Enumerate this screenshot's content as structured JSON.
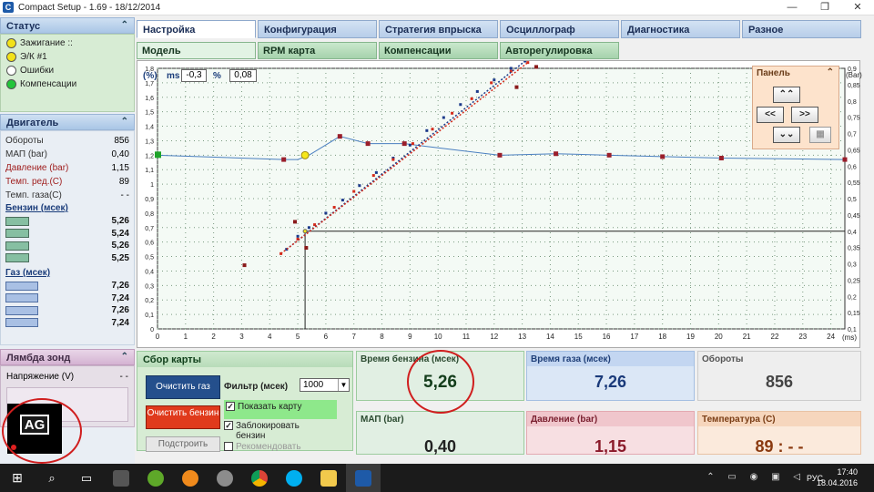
{
  "window": {
    "title": "Compact Setup - 1.69 - 18/12/2014",
    "min": "—",
    "max": "❐",
    "close": "✕"
  },
  "status": {
    "title": "Статус",
    "items": [
      {
        "label": "Зажигание ::",
        "color": "#f2e218"
      },
      {
        "label": "Э/К #1",
        "color": "#f2e218"
      },
      {
        "label": "Ошибки",
        "color": "#ffffff"
      },
      {
        "label": "Компенсации",
        "color": "#22c53a"
      }
    ]
  },
  "engine": {
    "title": "Двигатель",
    "rows": [
      {
        "label": "Обороты",
        "value": "856",
        "red": false
      },
      {
        "label": "МАП (bar)",
        "value": "0,40",
        "red": false
      },
      {
        "label": "Давление (bar)",
        "value": "1,15",
        "red": true
      },
      {
        "label": "Темп. ред.(C)",
        "value": "89",
        "red": true
      },
      {
        "label": "Темп. газа(C)",
        "value": "- -",
        "red": false
      }
    ],
    "petrol_title": "Бензин (мсек)",
    "petrol": [
      "5,26",
      "5,24",
      "5,26",
      "5,25"
    ],
    "gas_title": "Газ (мсек)",
    "gas": [
      "7,26",
      "7,24",
      "7,26",
      "7,24"
    ]
  },
  "lambda": {
    "title": "Лямбда зонд",
    "voltage_label": "Напряжение (V)",
    "voltage_value": "- -"
  },
  "logo_text": "AG",
  "tabs1": [
    "Настройка",
    "Конфигурация",
    "Стратегия впрыска",
    "Осциллограф",
    "Диагностика",
    "Разное"
  ],
  "tabs2": [
    "Модель",
    "RPM карта",
    "Компенсации",
    "Авторегулировка"
  ],
  "chart_controls": {
    "unit_left": "(%)",
    "ms_label": "ms",
    "ms_value": "-0,3",
    "pct_label": "%",
    "pct_value": "0,08",
    "unit_right": "(Bar)",
    "x_unit": "(ms)"
  },
  "panel": {
    "title": "Панель",
    "up": "⌃⌃",
    "left": "<<",
    "right": ">>",
    "down": "⌄⌄"
  },
  "chart_data": {
    "type": "scatter",
    "x_ticks": [
      0,
      1,
      2,
      3,
      4,
      5,
      6,
      7,
      8,
      9,
      10,
      11,
      12,
      13,
      14,
      15,
      16,
      17,
      18,
      19,
      20,
      21,
      22,
      23,
      24
    ],
    "xlim": [
      0,
      24.5
    ],
    "left_ticks": [
      "0",
      "0,1",
      "0,2",
      "0,3",
      "0,4",
      "0,5",
      "0,6",
      "0,7",
      "0,8",
      "0,9",
      "1",
      "1,1",
      "1,2",
      "1,3",
      "1,4",
      "1,5",
      "1,6",
      "1,7",
      "1,8"
    ],
    "right_ticks": [
      "0,1",
      "0,15",
      "0,2",
      "0,25",
      "0,3",
      "0,35",
      "0,4",
      "0,45",
      "0,5",
      "0,55",
      "0,6",
      "0,65",
      "0,7",
      "0,75",
      "0,8",
      "0,85",
      "0,9"
    ],
    "ylim_left": [
      0,
      1.8
    ],
    "ylim_right": [
      0.1,
      0.9
    ],
    "grid": true,
    "correction_curve": [
      [
        0,
        1.2
      ],
      [
        4.5,
        1.17
      ],
      [
        5,
        1.17
      ],
      [
        5.4,
        1.2
      ],
      [
        6.5,
        1.33
      ],
      [
        7.5,
        1.28
      ],
      [
        8.8,
        1.28
      ],
      [
        9.6,
        1.26
      ],
      [
        12.2,
        1.2
      ],
      [
        14.2,
        1.21
      ],
      [
        16.1,
        1.2
      ],
      [
        18,
        1.19
      ],
      [
        20.1,
        1.18
      ],
      [
        24.5,
        1.17
      ]
    ],
    "correction_markers": [
      [
        4.5,
        1.17
      ],
      [
        6.5,
        1.33
      ],
      [
        7.5,
        1.28
      ],
      [
        8.8,
        1.28
      ],
      [
        12.2,
        1.2
      ],
      [
        14.2,
        1.21
      ],
      [
        16.1,
        1.2
      ],
      [
        18,
        1.19
      ],
      [
        20.1,
        1.18
      ],
      [
        24.5,
        1.17
      ]
    ],
    "gas_vs_petrol_blue": [
      [
        4.6,
        0.55
      ],
      [
        5,
        0.64
      ],
      [
        5.4,
        0.7
      ],
      [
        6,
        0.8
      ],
      [
        6.6,
        0.89
      ],
      [
        7.2,
        0.99
      ],
      [
        7.8,
        1.08
      ],
      [
        8.4,
        1.18
      ],
      [
        9,
        1.27
      ],
      [
        9.6,
        1.37
      ],
      [
        10.2,
        1.46
      ],
      [
        10.8,
        1.55
      ],
      [
        11.4,
        1.64
      ],
      [
        12,
        1.72
      ],
      [
        12.6,
        1.8
      ],
      [
        13.1,
        1.85
      ]
    ],
    "gas_vs_petrol_red": [
      [
        4.4,
        0.52
      ],
      [
        5,
        0.62
      ],
      [
        5.6,
        0.72
      ],
      [
        6.3,
        0.84
      ],
      [
        7,
        0.95
      ],
      [
        7.7,
        1.06
      ],
      [
        8.4,
        1.17
      ],
      [
        9.1,
        1.28
      ],
      [
        9.8,
        1.38
      ],
      [
        10.5,
        1.49
      ],
      [
        11.2,
        1.59
      ],
      [
        11.9,
        1.7
      ],
      [
        12.6,
        1.78
      ],
      [
        13.2,
        1.84
      ]
    ],
    "outliers": [
      [
        3.1,
        0.44
      ],
      [
        4.9,
        0.74
      ],
      [
        5.3,
        0.56
      ],
      [
        13.7,
        1.91
      ],
      [
        13.5,
        1.81
      ],
      [
        12.8,
        1.67
      ]
    ],
    "cursor": {
      "x": 5.26,
      "y_right": 0.4,
      "point_y": 1.2
    }
  },
  "collect": {
    "title": "Сбор карты",
    "clear_gas": "Очистить газ",
    "clear_petrol": "Очистить бензин",
    "build": "Подстроить",
    "filter_label": "Фильтр (мсек)",
    "filter_value": "1000",
    "show_map": "Показать карту",
    "lock_petrol": "Заблокировать бензин",
    "recommend": "Рекомендовать"
  },
  "tiles": {
    "petrol_time": {
      "label": "Время бензина (мсек)",
      "value": "5,26"
    },
    "gas_time": {
      "label": "Время газа (мсек)",
      "value": "7,26"
    },
    "rpm": {
      "label": "Обороты",
      "value": "856"
    },
    "map": {
      "label": "МАП (bar)",
      "value": "0,40"
    },
    "pressure": {
      "label": "Давление (bar)",
      "value": "1,15"
    },
    "temp": {
      "label": "Температура (C)",
      "value": "89 : - -"
    }
  },
  "tray": {
    "lang": "РУС",
    "time": "17:40",
    "date": "18.04.2016"
  },
  "colors": {
    "petrol_tile": "#e1efe3",
    "gas_tile": "#dbe7f6",
    "rpm_tile": "#eeeeee",
    "pressure_tile": "#f7dfe2",
    "temp_tile": "#fbeadc"
  }
}
